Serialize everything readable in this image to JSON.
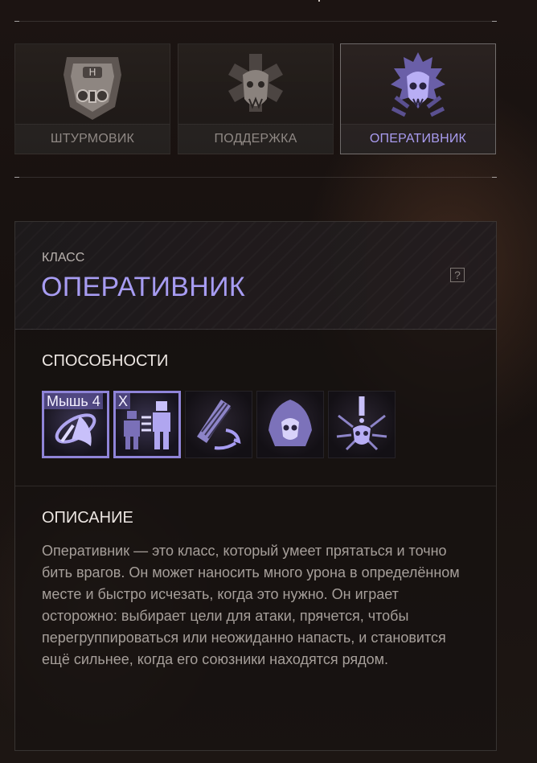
{
  "class_tabs": [
    {
      "label": "ШТУРМОВИК",
      "icon": "assault-emblem-icon",
      "selected": false
    },
    {
      "label": "ПОДДЕРЖКА",
      "icon": "support-emblem-icon",
      "selected": false
    },
    {
      "label": "ОПЕРАТИВНИК",
      "icon": "operative-emblem-icon",
      "selected": true
    }
  ],
  "class_panel": {
    "eyebrow": "КЛАСС",
    "title": "ОПЕРАТИВНИК",
    "help_label": "?"
  },
  "abilities_section": {
    "title": "СПОСОБНОСТИ",
    "items": [
      {
        "icon": "dash-ability-icon",
        "key": "Мышь 4"
      },
      {
        "icon": "decoy-ability-icon",
        "key": "X"
      },
      {
        "icon": "ammo-swap-ability-icon",
        "key": ""
      },
      {
        "icon": "hooded-skull-ability-icon",
        "key": ""
      },
      {
        "icon": "skull-burst-ability-icon",
        "key": ""
      }
    ]
  },
  "description_section": {
    "title": "ОПИСАНИЕ",
    "text": "Оперативник — это класс, который умеет прятаться и точно бить врагов. Он может наносить много урона в определённом месте и быстро исчезать, когда это нужно. Он играет осторожно: выбирает цели для атаки, прячется, чтобы перегруппироваться или неожиданно напасть, и становится ещё сильнее, когда его союзники находятся рядом."
  },
  "colors": {
    "accent": "#a79cf2",
    "selected_border": "#8f84d8",
    "text_muted": "#a69f9a"
  }
}
